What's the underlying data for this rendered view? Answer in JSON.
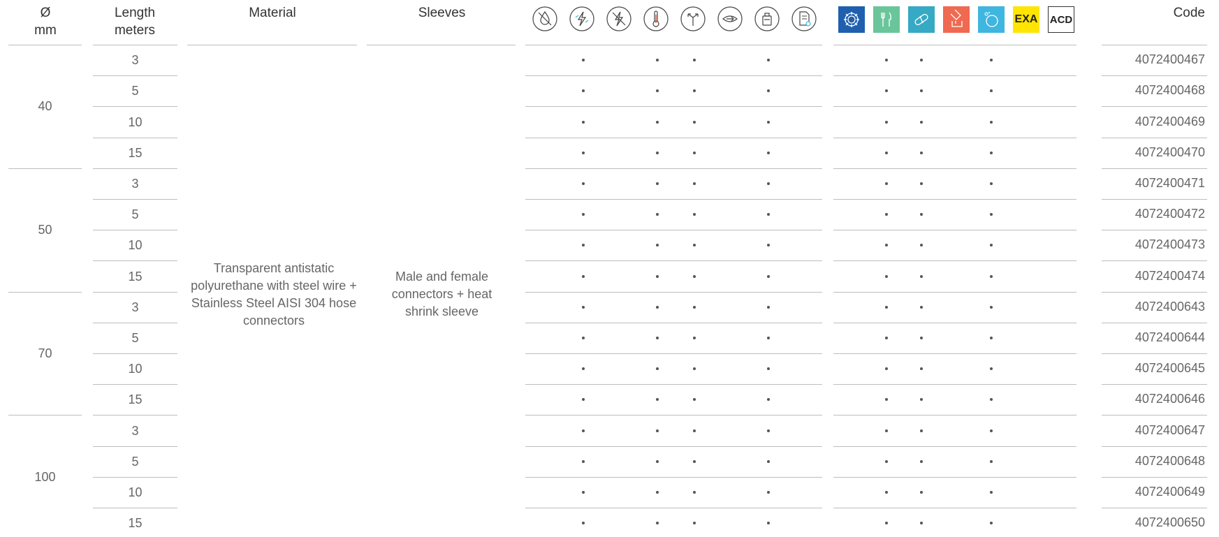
{
  "header": {
    "diameter": "Ø",
    "diameter_unit": "mm",
    "length": "Length",
    "length_unit": "meters",
    "material": "Material",
    "sleeves": "Sleeves",
    "code": "Code"
  },
  "property_icons": [
    "no-drop-icon",
    "antistatic-icon",
    "no-electricity-icon",
    "thermometer-icon",
    "bend-arrows-icon",
    "vacuum-icon",
    "container-icon",
    "document-certificate-icon"
  ],
  "category_icons": [
    {
      "name": "industry-gear-icon",
      "color": "#1f5fae",
      "label": ""
    },
    {
      "name": "food-cutlery-icon",
      "color": "#6ac59b",
      "label": ""
    },
    {
      "name": "pharma-pill-icon",
      "color": "#36a9c4",
      "label": ""
    },
    {
      "name": "chemical-pour-icon",
      "color": "#ef6a50",
      "label": ""
    },
    {
      "name": "cosmetics-bubble-icon",
      "color": "#3fb6df",
      "label": ""
    },
    {
      "name": "atex-exa-icon",
      "color": "#ffe500",
      "label": "EXA"
    },
    {
      "name": "acd-icon",
      "color": "#ffffff",
      "label": "ACD"
    }
  ],
  "material_text": "Transparent antistatic polyurethane with steel wire + Stainless Steel AISI 304 hose connectors",
  "sleeves_text": "Male and female connectors + heat shrink sleeve",
  "diameters": [
    "40",
    "50",
    "70",
    "100"
  ],
  "rows": [
    {
      "length": "3",
      "code": "4072400467"
    },
    {
      "length": "5",
      "code": "4072400468"
    },
    {
      "length": "10",
      "code": "4072400469"
    },
    {
      "length": "15",
      "code": "4072400470"
    },
    {
      "length": "3",
      "code": "4072400471"
    },
    {
      "length": "5",
      "code": "4072400472"
    },
    {
      "length": "10",
      "code": "4072400473"
    },
    {
      "length": "15",
      "code": "4072400474"
    },
    {
      "length": "3",
      "code": "4072400643"
    },
    {
      "length": "5",
      "code": "4072400644"
    },
    {
      "length": "10",
      "code": "4072400645"
    },
    {
      "length": "15",
      "code": "4072400646"
    },
    {
      "length": "3",
      "code": "4072400647"
    },
    {
      "length": "5",
      "code": "4072400648"
    },
    {
      "length": "10",
      "code": "4072400649"
    },
    {
      "length": "15",
      "code": "4072400650"
    }
  ],
  "property_dots": [
    false,
    true,
    false,
    true,
    true,
    false,
    true,
    false
  ],
  "category_dots": [
    false,
    true,
    true,
    false,
    true,
    false,
    false
  ]
}
